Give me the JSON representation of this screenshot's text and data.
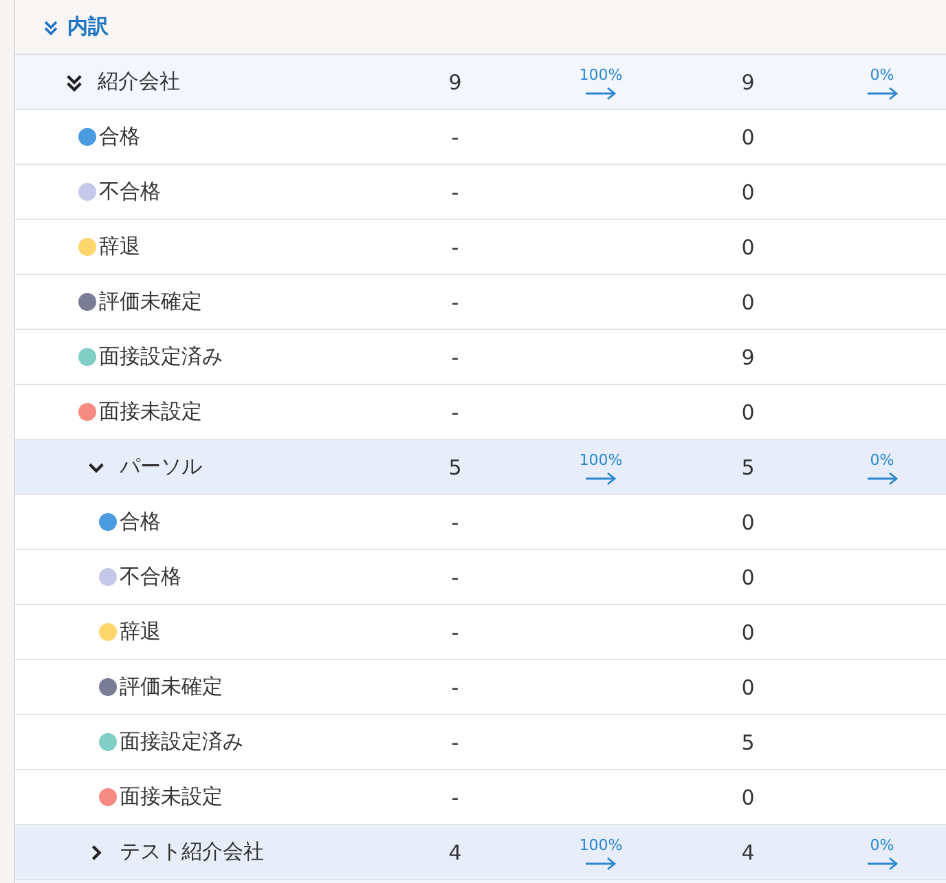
{
  "section": {
    "title": "内訳",
    "expanded": true,
    "groups": [
      {
        "name": "紹介会社",
        "expanded": true,
        "count_1": "9",
        "rate_1": "100%",
        "count_2": "9",
        "rate_2": "0%",
        "statuses": [
          {
            "label": "合格",
            "color": "#4a9be0",
            "count_1": "-",
            "count_2": "0"
          },
          {
            "label": "不合格",
            "color": "#c5c8e8",
            "count_1": "-",
            "count_2": "0"
          },
          {
            "label": "辞退",
            "color": "#fdd56a",
            "count_1": "-",
            "count_2": "0"
          },
          {
            "label": "評価未確定",
            "color": "#7b7d96",
            "count_1": "-",
            "count_2": "0"
          },
          {
            "label": "面接設定済み",
            "color": "#7fcfc4",
            "count_1": "-",
            "count_2": "9"
          },
          {
            "label": "面接未設定",
            "color": "#f78a82",
            "count_1": "-",
            "count_2": "0"
          }
        ],
        "children": [
          {
            "name": "パーソル",
            "expanded": true,
            "count_1": "5",
            "rate_1": "100%",
            "count_2": "5",
            "rate_2": "0%",
            "statuses": [
              {
                "label": "合格",
                "color": "#4a9be0",
                "count_1": "-",
                "count_2": "0"
              },
              {
                "label": "不合格",
                "color": "#c5c8e8",
                "count_1": "-",
                "count_2": "0"
              },
              {
                "label": "辞退",
                "color": "#fdd56a",
                "count_1": "-",
                "count_2": "0"
              },
              {
                "label": "評価未確定",
                "color": "#7b7d96",
                "count_1": "-",
                "count_2": "0"
              },
              {
                "label": "面接設定済み",
                "color": "#7fcfc4",
                "count_1": "-",
                "count_2": "5"
              },
              {
                "label": "面接未設定",
                "color": "#f78a82",
                "count_1": "-",
                "count_2": "0"
              }
            ]
          },
          {
            "name": "テスト紹介会社",
            "expanded": false,
            "count_1": "4",
            "rate_1": "100%",
            "count_2": "4",
            "rate_2": "0%"
          }
        ]
      }
    ]
  }
}
